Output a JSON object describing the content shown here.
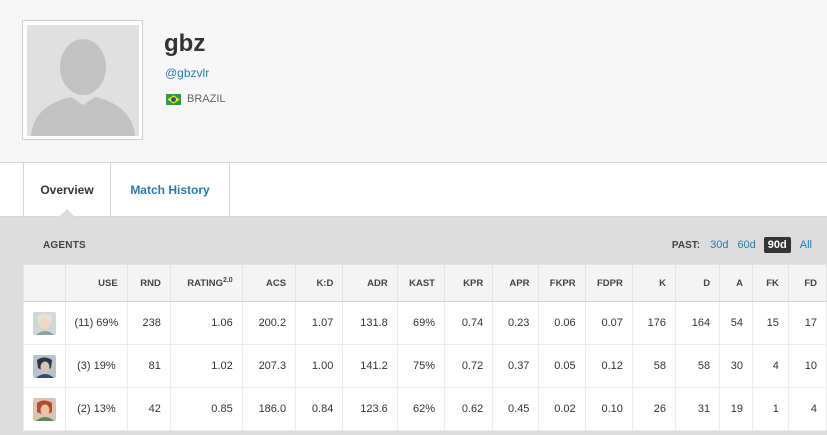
{
  "profile": {
    "name": "gbz",
    "handle": "@gbzvlr",
    "country": "BRAZIL"
  },
  "tabs": [
    {
      "label": "Overview",
      "active": true
    },
    {
      "label": "Match History",
      "active": false
    }
  ],
  "agents_section": {
    "title": "AGENTS",
    "past_label": "PAST:",
    "periods": [
      "30d",
      "60d",
      "90d",
      "All"
    ],
    "active_period": "90d"
  },
  "table": {
    "headers": [
      "USE",
      "RND",
      "RATING",
      "ACS",
      "K:D",
      "ADR",
      "KAST",
      "KPR",
      "APR",
      "FKPR",
      "FDPR",
      "K",
      "D",
      "A",
      "FK",
      "FD"
    ],
    "rating_sup": "2.0",
    "rows": [
      {
        "agent_icon": "agent-portrait-icon",
        "cells": [
          "(11) 69%",
          "238",
          "1.06",
          "200.2",
          "1.07",
          "131.8",
          "69%",
          "0.74",
          "0.23",
          "0.06",
          "0.07",
          "176",
          "164",
          "54",
          "15",
          "17"
        ]
      },
      {
        "agent_icon": "agent-portrait-icon",
        "cells": [
          "(3) 19%",
          "81",
          "1.02",
          "207.3",
          "1.00",
          "141.2",
          "75%",
          "0.72",
          "0.37",
          "0.05",
          "0.12",
          "58",
          "58",
          "30",
          "4",
          "10"
        ]
      },
      {
        "agent_icon": "agent-portrait-icon",
        "cells": [
          "(2) 13%",
          "42",
          "0.85",
          "186.0",
          "0.84",
          "123.6",
          "62%",
          "0.62",
          "0.45",
          "0.02",
          "0.10",
          "26",
          "31",
          "19",
          "1",
          "4"
        ]
      }
    ]
  },
  "colors": {
    "link": "#2a7ab0",
    "active_period_bg": "#333333",
    "page_bg": "#dcdcdc"
  }
}
